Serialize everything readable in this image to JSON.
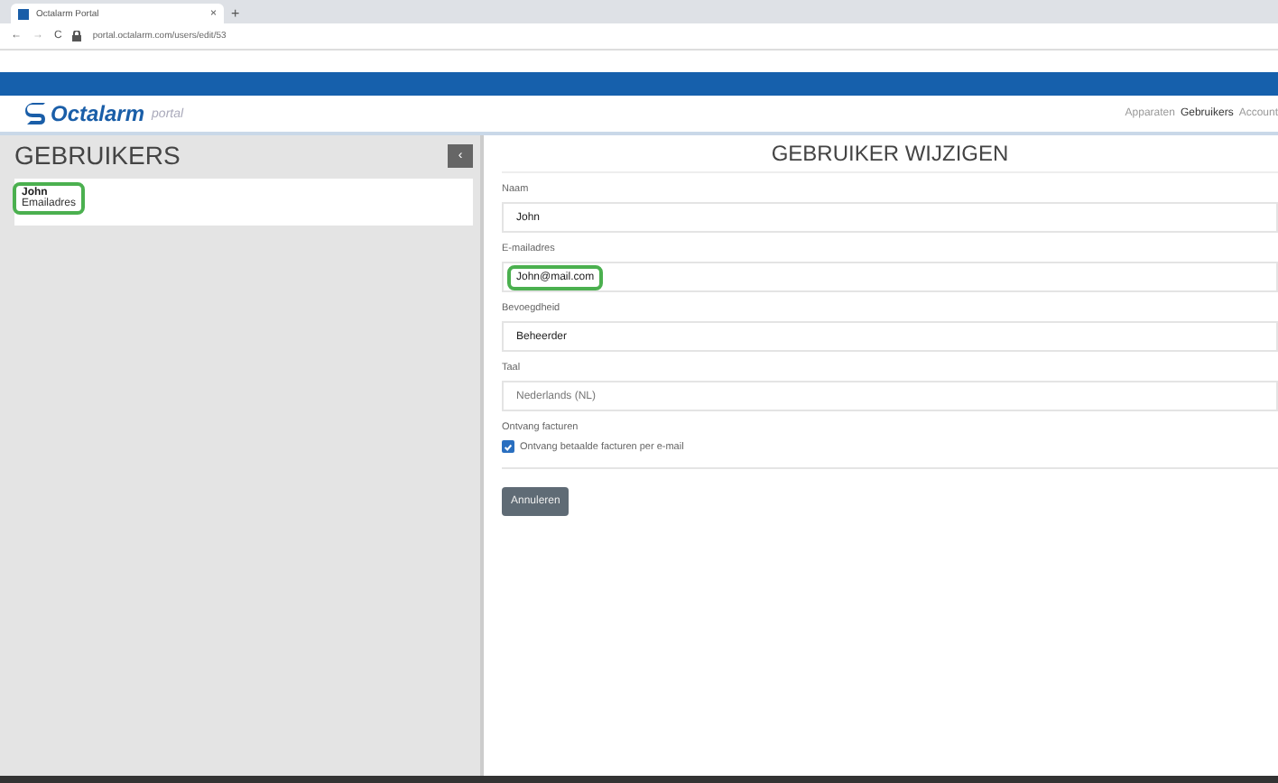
{
  "browser": {
    "tab_title": "Octalarm Portal",
    "tab_close": "×",
    "new_tab": "+",
    "back": "←",
    "forward": "→",
    "reload": "C",
    "url": "portal.octalarm.com/users/edit/53"
  },
  "header": {
    "logo": "Octalarm",
    "logo_suffix": "portal",
    "nav": [
      {
        "label": "Apparaten",
        "selected": false
      },
      {
        "label": "Gebruikers",
        "selected": true
      },
      {
        "label": "Account",
        "selected": false
      }
    ]
  },
  "sidebar": {
    "title": "GEBRUIKERS",
    "collapse": "‹",
    "items": [
      {
        "name": "John",
        "email": "Emailadres",
        "highlighted": true
      }
    ]
  },
  "form": {
    "title": "GEBRUIKER WIJZIGEN",
    "fields": [
      {
        "label": "Naam",
        "value": "John",
        "highlighted": false,
        "disabled": false
      },
      {
        "label": "E-mailadres",
        "value": "John@mail.com",
        "highlighted": true,
        "disabled": false
      },
      {
        "label": "Bevoegdheid",
        "value": "Beheerder",
        "highlighted": false,
        "disabled": false
      },
      {
        "label": "Taal",
        "value": "Nederlands (NL)",
        "highlighted": false,
        "disabled": true
      }
    ],
    "checkbox_group": "Ontvang facturen",
    "checkbox": {
      "label": "Ontvang betaalde facturen per e-mail",
      "checked": true
    },
    "cancel": "Annuleren"
  }
}
